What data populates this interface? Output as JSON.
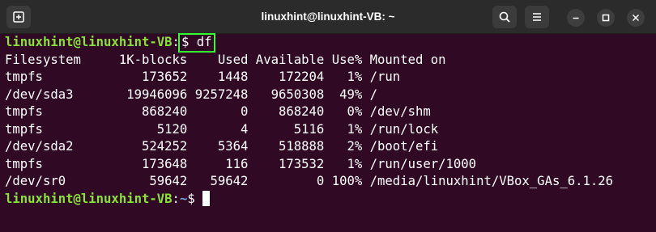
{
  "window": {
    "title": "linuxhint@linuxhint-VB: ~"
  },
  "terminal": {
    "prompt1": {
      "user_host": "linuxhint@linuxhint-VB",
      "colon": ":",
      "command": "$ df"
    },
    "output_lines": [
      "Filesystem     1K-blocks    Used Available Use% Mounted on",
      "tmpfs             173652    1448    172204   1% /run",
      "/dev/sda3       19946096 9257248   9650308  49% /",
      "tmpfs             868240       0    868240   0% /dev/shm",
      "tmpfs               5120       4      5116   1% /run/lock",
      "/dev/sda2         524252    5364    518888   2% /boot/efi",
      "tmpfs             173648     116    173532   1% /run/user/1000",
      "/dev/sr0           59642   59642         0 100% /media/linuxhint/VBox_GAs_6.1.26"
    ],
    "prompt2": {
      "user_host": "linuxhint@linuxhint-VB",
      "colon": ":",
      "path": "~",
      "symbol": "$ "
    }
  },
  "icons": {
    "new_tab": "new-tab-icon",
    "search": "search-icon",
    "menu": "hamburger-menu-icon",
    "minimize": "minimize-icon",
    "maximize": "maximize-icon",
    "close": "close-icon"
  },
  "colors": {
    "terminal_bg": "#300a24",
    "titlebar_bg": "#2b2b2b",
    "user_host": "#8ae234",
    "path": "#729fcf",
    "highlight_box": "#33ff33",
    "text": "#ffffff"
  }
}
